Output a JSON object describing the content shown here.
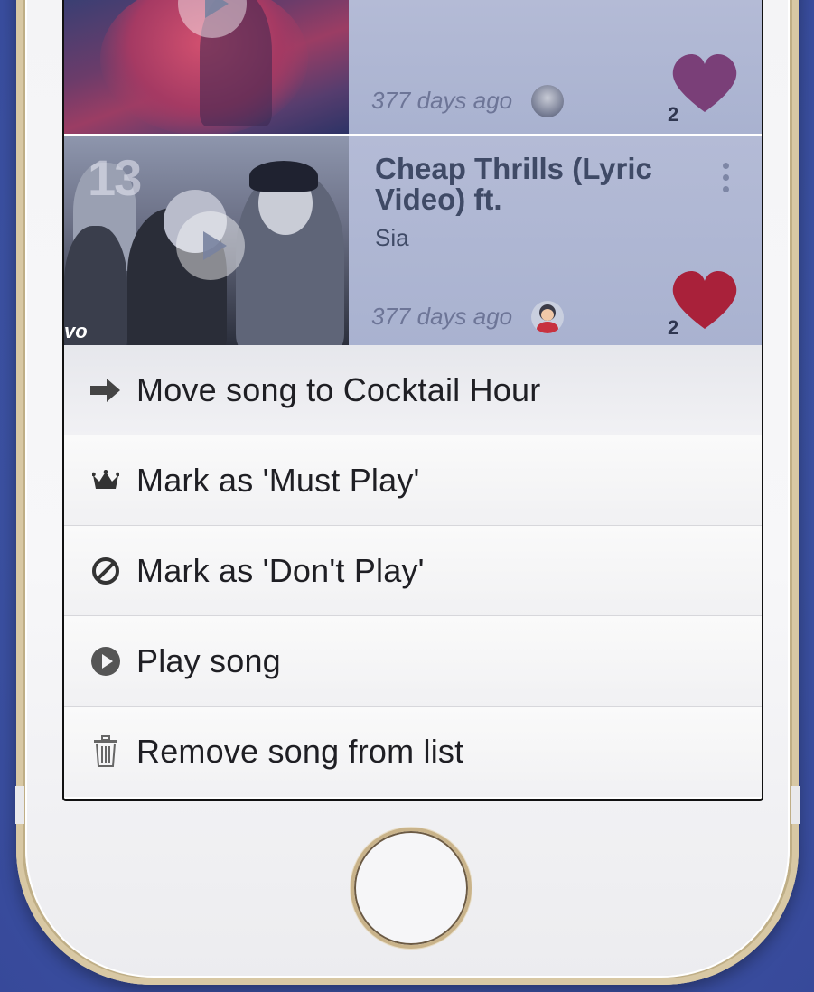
{
  "songs": [
    {
      "title": "",
      "artist": "",
      "age": "377 days ago",
      "likes": "2",
      "heart_color": "#7a3f78"
    },
    {
      "title": "Cheap Thrills (Lyric Video) ft.",
      "artist": "Sia",
      "age": "377 days ago",
      "likes": "2",
      "heart_color": "#a9213a",
      "thumb_number": "13",
      "thumb_logo": "vo"
    }
  ],
  "menu": {
    "items": [
      {
        "label": "Move song to Cocktail Hour",
        "icon": "arrow-right-icon"
      },
      {
        "label": "Mark as 'Must Play'",
        "icon": "crown-icon"
      },
      {
        "label": "Mark as 'Don't Play'",
        "icon": "ban-icon"
      },
      {
        "label": "Play song",
        "icon": "play-circle-icon"
      },
      {
        "label": "Remove song from list",
        "icon": "trash-icon"
      }
    ]
  },
  "colors": {
    "background": "#3f56a8",
    "row_overlay": "#aeb6d2",
    "title_text": "#3f4a66",
    "menu_text": "#1f1f24"
  }
}
